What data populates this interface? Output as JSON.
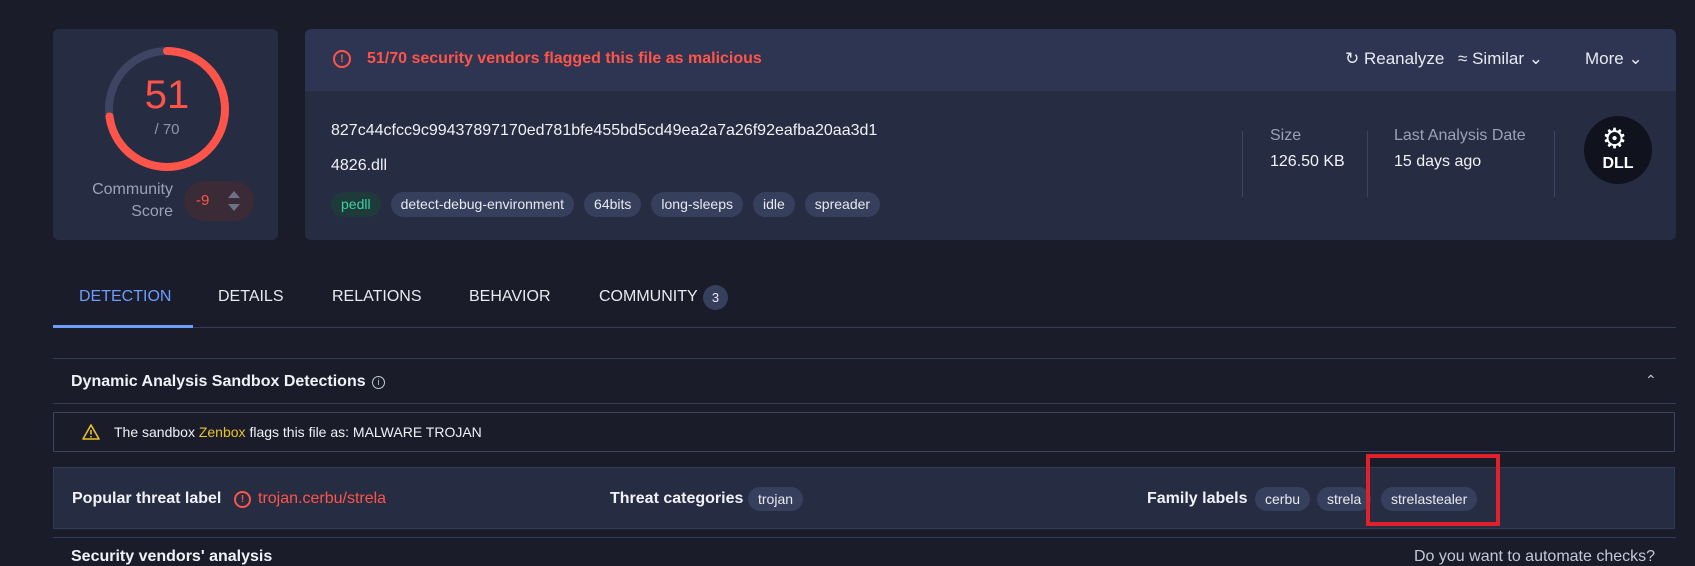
{
  "score": {
    "detections": "51",
    "total": "/ 70",
    "community_label_1": "Community",
    "community_label_2": "Score",
    "community_value": "-9",
    "ratio": 0.7286
  },
  "header": {
    "alert": "51/70 security vendors flagged this file as malicious",
    "buttons": {
      "reanalyze": "Reanalyze",
      "similar": "Similar",
      "more": "More"
    }
  },
  "file": {
    "hash": "827c44cfcc9c99437897170ed781bfe455bd5cd49ea2a7a26f92eafba20aa3d1",
    "name": "4826.dll",
    "tags": [
      "pedll",
      "detect-debug-environment",
      "64bits",
      "long-sleeps",
      "idle",
      "spreader"
    ],
    "size_label": "Size",
    "size_value": "126.50 KB",
    "date_label": "Last Analysis Date",
    "date_value": "15 days ago",
    "type_badge": "DLL"
  },
  "tabs": [
    {
      "label": "DETECTION",
      "active": true
    },
    {
      "label": "DETAILS"
    },
    {
      "label": "RELATIONS"
    },
    {
      "label": "BEHAVIOR"
    },
    {
      "label": "COMMUNITY",
      "count": "3"
    }
  ],
  "sandbox": {
    "title": "Dynamic Analysis Sandbox Detections",
    "warn_prefix": "The sandbox",
    "warn_name": "Zenbox",
    "warn_suffix": "flags this file as: MALWARE TROJAN"
  },
  "threat": {
    "popular_label": "Popular threat label",
    "popular_value": "trojan.cerbu/strela",
    "categories_label": "Threat categories",
    "categories": [
      "trojan"
    ],
    "family_label": "Family labels",
    "families": [
      "cerbu",
      "strela",
      "strelastealer"
    ]
  },
  "next_section": {
    "title": "Security vendors' analysis",
    "right": "Do you want to automate checks?"
  },
  "colors": {
    "malicious": "#ff5449",
    "accent": "#6f9cff",
    "highlight": "#e0202a"
  },
  "icons": {
    "reanalyze": "refresh-icon",
    "similar": "similar-icon",
    "more": "chevron-down-icon",
    "alert": "alert-circle-icon",
    "warning": "warning-triangle-icon"
  }
}
